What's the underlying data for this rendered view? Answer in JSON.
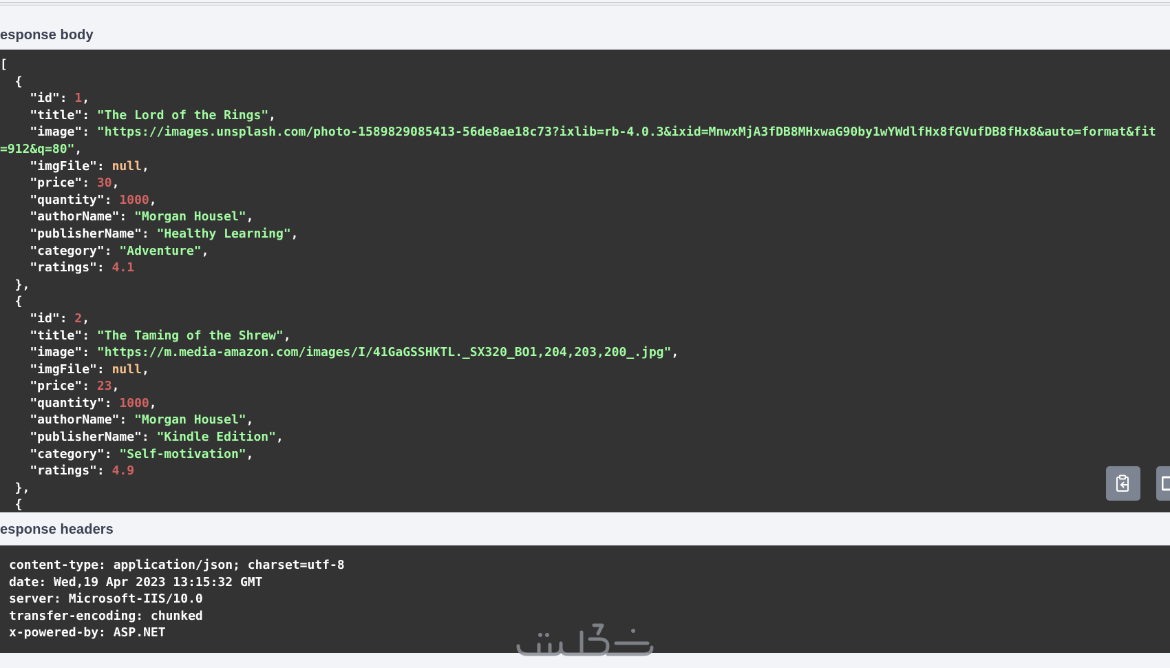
{
  "sections": {
    "response_body_label": "esponse body",
    "response_headers_label": "esponse headers"
  },
  "response_body": {
    "lines": [
      [
        {
          "t": "p",
          "v": "["
        }
      ],
      [
        {
          "t": "p",
          "v": "  {"
        }
      ],
      [
        {
          "t": "k",
          "v": "    \"id\""
        },
        {
          "t": "p",
          "v": ": "
        },
        {
          "t": "n",
          "v": "1"
        },
        {
          "t": "p",
          "v": ","
        }
      ],
      [
        {
          "t": "k",
          "v": "    \"title\""
        },
        {
          "t": "p",
          "v": ": "
        },
        {
          "t": "s",
          "v": "\"The Lord of the Rings\""
        },
        {
          "t": "p",
          "v": ","
        }
      ],
      [
        {
          "t": "k",
          "v": "    \"image\""
        },
        {
          "t": "p",
          "v": ": "
        },
        {
          "t": "s",
          "v": "\"https://images.unsplash.com/photo-1589829085413-56de8ae18c73?ixlib=rb-4.0.3&ixid=MnwxMjA3fDB8MHxwaG90by1wYWdlfHx8fGVufDB8fHx8&auto=format&fit"
        }
      ],
      [
        {
          "t": "s",
          "v": "=912&q=80\""
        },
        {
          "t": "p",
          "v": ","
        }
      ],
      [
        {
          "t": "k",
          "v": "    \"imgFile\""
        },
        {
          "t": "p",
          "v": ": "
        },
        {
          "t": "nl",
          "v": "null"
        },
        {
          "t": "p",
          "v": ","
        }
      ],
      [
        {
          "t": "k",
          "v": "    \"price\""
        },
        {
          "t": "p",
          "v": ": "
        },
        {
          "t": "n",
          "v": "30"
        },
        {
          "t": "p",
          "v": ","
        }
      ],
      [
        {
          "t": "k",
          "v": "    \"quantity\""
        },
        {
          "t": "p",
          "v": ": "
        },
        {
          "t": "n",
          "v": "1000"
        },
        {
          "t": "p",
          "v": ","
        }
      ],
      [
        {
          "t": "k",
          "v": "    \"authorName\""
        },
        {
          "t": "p",
          "v": ": "
        },
        {
          "t": "s",
          "v": "\"Morgan Housel\""
        },
        {
          "t": "p",
          "v": ","
        }
      ],
      [
        {
          "t": "k",
          "v": "    \"publisherName\""
        },
        {
          "t": "p",
          "v": ": "
        },
        {
          "t": "s",
          "v": "\"Healthy Learning\""
        },
        {
          "t": "p",
          "v": ","
        }
      ],
      [
        {
          "t": "k",
          "v": "    \"category\""
        },
        {
          "t": "p",
          "v": ": "
        },
        {
          "t": "s",
          "v": "\"Adventure\""
        },
        {
          "t": "p",
          "v": ","
        }
      ],
      [
        {
          "t": "k",
          "v": "    \"ratings\""
        },
        {
          "t": "p",
          "v": ": "
        },
        {
          "t": "n",
          "v": "4.1"
        }
      ],
      [
        {
          "t": "p",
          "v": "  },"
        }
      ],
      [
        {
          "t": "p",
          "v": "  {"
        }
      ],
      [
        {
          "t": "k",
          "v": "    \"id\""
        },
        {
          "t": "p",
          "v": ": "
        },
        {
          "t": "n",
          "v": "2"
        },
        {
          "t": "p",
          "v": ","
        }
      ],
      [
        {
          "t": "k",
          "v": "    \"title\""
        },
        {
          "t": "p",
          "v": ": "
        },
        {
          "t": "s",
          "v": "\"The Taming of the Shrew\""
        },
        {
          "t": "p",
          "v": ","
        }
      ],
      [
        {
          "t": "k",
          "v": "    \"image\""
        },
        {
          "t": "p",
          "v": ": "
        },
        {
          "t": "s",
          "v": "\"https://m.media-amazon.com/images/I/41GaGSSHKTL._SX320_BO1,204,203,200_.jpg\""
        },
        {
          "t": "p",
          "v": ","
        }
      ],
      [
        {
          "t": "k",
          "v": "    \"imgFile\""
        },
        {
          "t": "p",
          "v": ": "
        },
        {
          "t": "nl",
          "v": "null"
        },
        {
          "t": "p",
          "v": ","
        }
      ],
      [
        {
          "t": "k",
          "v": "    \"price\""
        },
        {
          "t": "p",
          "v": ": "
        },
        {
          "t": "n",
          "v": "23"
        },
        {
          "t": "p",
          "v": ","
        }
      ],
      [
        {
          "t": "k",
          "v": "    \"quantity\""
        },
        {
          "t": "p",
          "v": ": "
        },
        {
          "t": "n",
          "v": "1000"
        },
        {
          "t": "p",
          "v": ","
        }
      ],
      [
        {
          "t": "k",
          "v": "    \"authorName\""
        },
        {
          "t": "p",
          "v": ": "
        },
        {
          "t": "s",
          "v": "\"Morgan Housel\""
        },
        {
          "t": "p",
          "v": ","
        }
      ],
      [
        {
          "t": "k",
          "v": "    \"publisherName\""
        },
        {
          "t": "p",
          "v": ": "
        },
        {
          "t": "s",
          "v": "\"Kindle Edition\""
        },
        {
          "t": "p",
          "v": ","
        }
      ],
      [
        {
          "t": "k",
          "v": "    \"category\""
        },
        {
          "t": "p",
          "v": ": "
        },
        {
          "t": "s",
          "v": "\"Self-motivation\""
        },
        {
          "t": "p",
          "v": ","
        }
      ],
      [
        {
          "t": "k",
          "v": "    \"ratings\""
        },
        {
          "t": "p",
          "v": ": "
        },
        {
          "t": "n",
          "v": "4.9"
        }
      ],
      [
        {
          "t": "p",
          "v": "  },"
        }
      ],
      [
        {
          "t": "p",
          "v": "  {"
        }
      ]
    ]
  },
  "response_headers": {
    "lines": [
      "content-type: application/json; charset=utf-8",
      "date: Wed,19 Apr 2023 13:15:32 GMT",
      "server: Microsoft-IIS/10.0",
      "transfer-encoding: chunked",
      "x-powered-by: ASP.NET"
    ]
  },
  "buttons": {
    "copy_icon": "clipboard-icon",
    "download_icon": "download-icon"
  },
  "watermark": {
    "icon": "khamsat-logo"
  },
  "colors": {
    "code_background": "#333333",
    "key": "#ffffff",
    "string": "#a2fca2",
    "number": "#d36363",
    "null": "#fcc28c",
    "button": "#7d8492",
    "page_background": "#f2f4f8"
  }
}
